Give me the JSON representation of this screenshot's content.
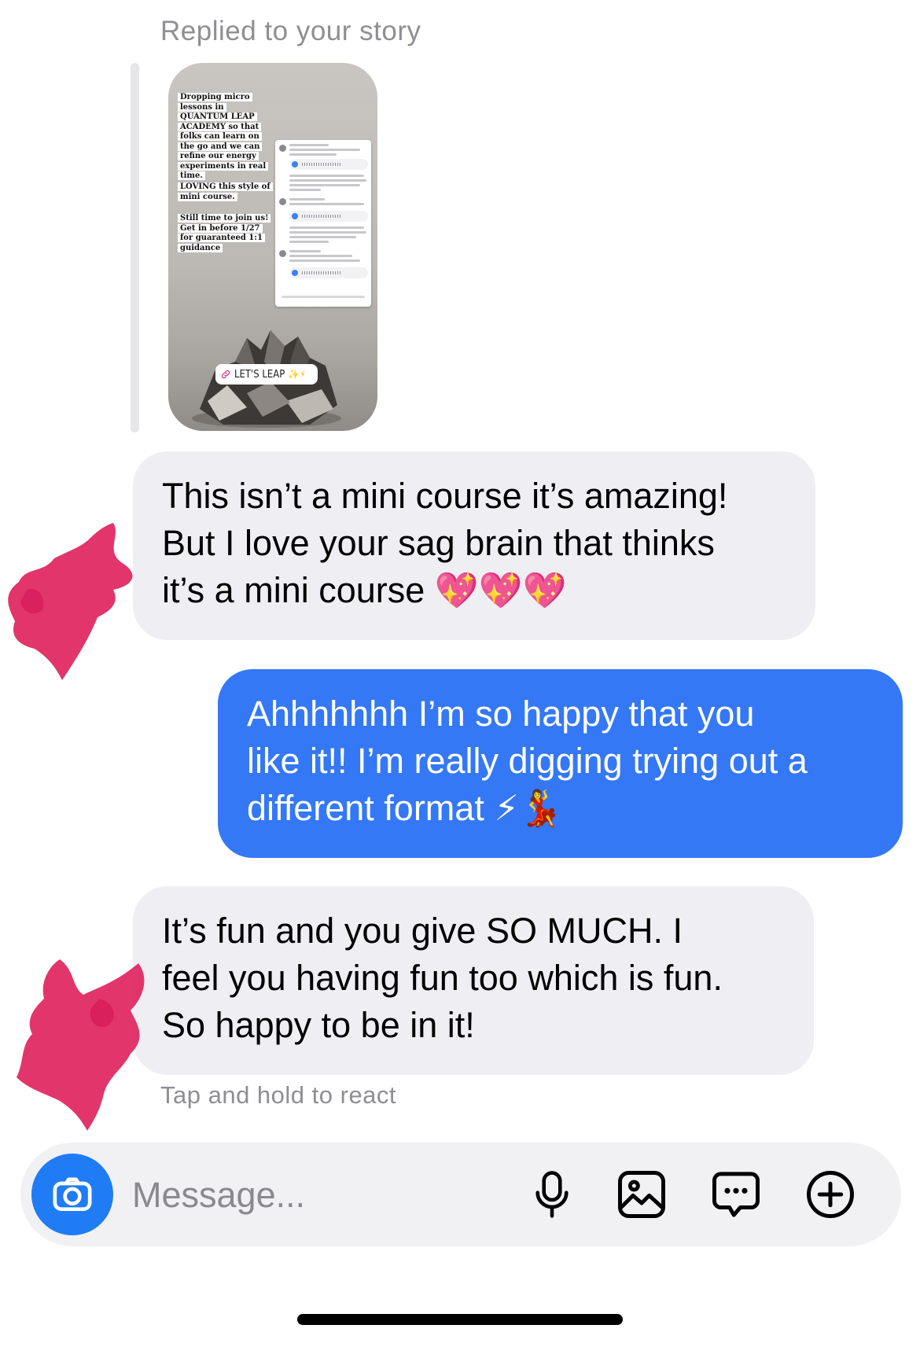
{
  "story_reply": {
    "caption": "Replied to your story",
    "story_text_blocks": [
      "Dropping micro lessons in QUANTUM LEAP ACADEMY so that folks can learn on the go and we can refine our energy experiments in real time.",
      "LOVING this style of mini course.",
      "Still time to join us! Get in before 1/27 for guaranteed 1:1 guidance"
    ],
    "sticker_label": "LET'S LEAP"
  },
  "messages": [
    {
      "direction": "incoming",
      "lines": [
        "This isn’t a mini course it’s amazing!",
        "But I love your sag brain that thinks",
        "it’s a mini course "
      ],
      "emoji": "💖💖💖"
    },
    {
      "direction": "outgoing",
      "lines": [
        "Ahhhhhhh I’m so happy that you",
        "like it!! I’m really digging trying out a",
        "different format "
      ],
      "emoji": "⚡💃"
    },
    {
      "direction": "incoming",
      "lines": [
        "It’s fun and you give SO MUCH. I",
        "feel you having fun too which is fun.",
        "So happy to be in it!"
      ],
      "emoji": ""
    }
  ],
  "hint": "Tap and hold to react",
  "composer": {
    "placeholder": "Message...",
    "camera_icon": "camera-icon",
    "tools": [
      "microphone-icon",
      "photo-icon",
      "sticker-icon",
      "add-icon"
    ]
  },
  "colors": {
    "outgoing_bubble": "#3478f6",
    "incoming_bubble": "#efeff3",
    "camera_button": "#1f7cf5",
    "redaction": "#e0245e"
  }
}
